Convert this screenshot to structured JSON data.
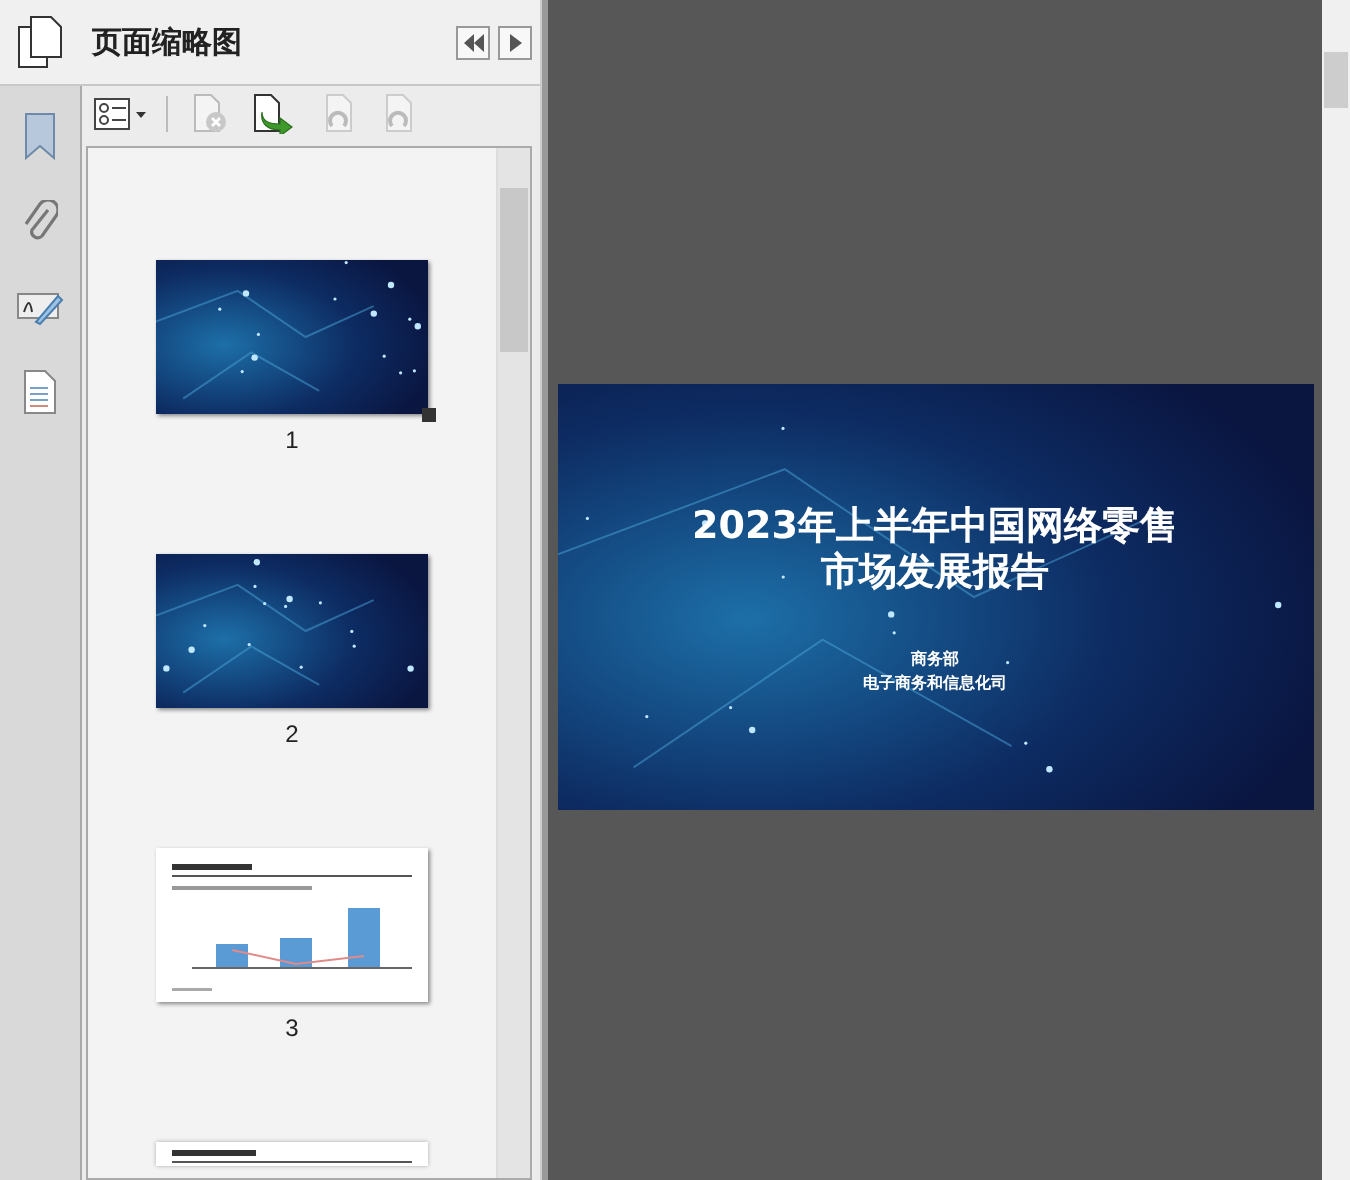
{
  "panel": {
    "title": "页面缩略图"
  },
  "side_tabs": [
    {
      "kind": "bookmark",
      "selected": false
    },
    {
      "kind": "attachment",
      "selected": false
    },
    {
      "kind": "signature",
      "selected": false
    },
    {
      "kind": "page",
      "selected": false
    }
  ],
  "thumbnails": [
    {
      "kind": "cover",
      "label": "1",
      "selected": true
    },
    {
      "kind": "section",
      "label": "2",
      "selected": false
    },
    {
      "kind": "chart",
      "label": "3",
      "selected": false
    },
    {
      "kind": "page",
      "selected": false
    }
  ],
  "slide": {
    "title": [
      "2023年上半年中国网络零售",
      "市场发展报告"
    ],
    "author": [
      "商务部",
      "电子商务和信息化司"
    ]
  }
}
